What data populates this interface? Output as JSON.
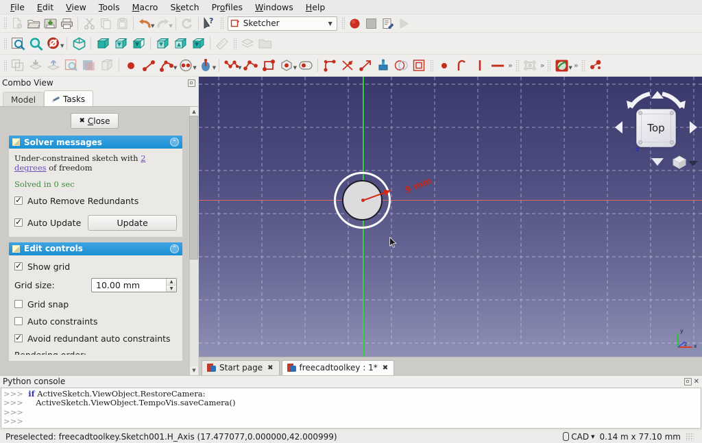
{
  "menubar": {
    "items": [
      {
        "label": "File",
        "mnemonic": "F"
      },
      {
        "label": "Edit",
        "mnemonic": "E"
      },
      {
        "label": "View",
        "mnemonic": "V"
      },
      {
        "label": "Tools",
        "mnemonic": "T"
      },
      {
        "label": "Macro",
        "mnemonic": "M"
      },
      {
        "label": "Sketch",
        "mnemonic": "k"
      },
      {
        "label": "Profiles",
        "mnemonic": "o"
      },
      {
        "label": "Windows",
        "mnemonic": "W"
      },
      {
        "label": "Help",
        "mnemonic": "H"
      }
    ]
  },
  "toolbar_file": {
    "buttons": [
      {
        "name": "new-document-icon",
        "title": "New"
      },
      {
        "name": "open-document-icon",
        "title": "Open"
      },
      {
        "name": "save-document-icon",
        "title": "Save"
      },
      {
        "name": "print-icon",
        "title": "Print"
      },
      {
        "name": "cut-icon",
        "title": "Cut"
      },
      {
        "name": "copy-icon",
        "title": "Copy"
      },
      {
        "name": "paste-icon",
        "title": "Paste"
      },
      {
        "name": "undo-icon",
        "title": "Undo"
      },
      {
        "name": "redo-icon",
        "title": "Redo"
      },
      {
        "name": "refresh-icon",
        "title": "Refresh"
      },
      {
        "name": "whats-this-icon",
        "title": "What's This?"
      }
    ]
  },
  "workbench": {
    "label": "Sketcher",
    "icon": "sketcher-workbench-icon",
    "arrow": "▼"
  },
  "toolbar_macro": {
    "buttons": [
      {
        "name": "macro-record-icon",
        "title": "Macro recording"
      },
      {
        "name": "macro-stop-icon",
        "title": "Stop macro recording"
      },
      {
        "name": "macros-dialog-icon",
        "title": "Macros..."
      },
      {
        "name": "macro-execute-icon",
        "title": "Execute macro"
      }
    ]
  },
  "toolbar_view": {
    "buttons": [
      {
        "name": "fit-all-icon",
        "title": "Fit all"
      },
      {
        "name": "fit-selection-icon",
        "title": "Fit selection"
      },
      {
        "name": "draw-style-icon",
        "title": "Draw style"
      },
      {
        "name": "isometric-view-icon",
        "title": "Isometric"
      },
      {
        "name": "front-view-icon",
        "title": "Front"
      },
      {
        "name": "top-view-icon",
        "title": "Top"
      },
      {
        "name": "right-view-icon",
        "title": "Right"
      },
      {
        "name": "rear-view-icon",
        "title": "Rear"
      },
      {
        "name": "bottom-view-icon",
        "title": "Bottom"
      },
      {
        "name": "left-view-icon",
        "title": "Left"
      },
      {
        "name": "measure-icon",
        "title": "Measure"
      },
      {
        "name": "workbench-layers-icon",
        "title": "Layers"
      },
      {
        "name": "folder-icon",
        "title": "Group"
      }
    ]
  },
  "toolbar_sketcher": {
    "buttons": [
      {
        "name": "create-sketch-icon",
        "title": "Create sketch"
      },
      {
        "name": "map-sketch-icon",
        "title": "Map sketch to face"
      },
      {
        "name": "reorient-sketch-icon",
        "title": "Reorient sketch"
      },
      {
        "name": "validate-sketch-icon",
        "title": "Validate sketch"
      },
      {
        "name": "merge-sketch-icon",
        "title": "Merge sketches"
      },
      {
        "name": "mirror-sketch-icon",
        "title": "Mirror sketch"
      },
      {
        "name": "point-geometry-icon",
        "title": "Create point"
      },
      {
        "name": "line-geometry-icon",
        "title": "Create line"
      },
      {
        "name": "arc-geometry-icon",
        "title": "Create arc"
      },
      {
        "name": "circle-geometry-icon",
        "title": "Create circle"
      },
      {
        "name": "conic-geometry-icon",
        "title": "Create conic"
      },
      {
        "name": "bspline-geometry-icon",
        "title": "Create B-spline"
      },
      {
        "name": "polyline-geometry-icon",
        "title": "Create polyline"
      },
      {
        "name": "rectangle-geometry-icon",
        "title": "Create rectangle"
      },
      {
        "name": "polygon-geometry-icon",
        "title": "Create regular polygon"
      },
      {
        "name": "slot-geometry-icon",
        "title": "Create slot"
      },
      {
        "name": "fillet-icon",
        "title": "Create fillet"
      },
      {
        "name": "trim-edge-icon",
        "title": "Trim edge"
      },
      {
        "name": "extend-edge-icon",
        "title": "Extend edge"
      },
      {
        "name": "external-geometry-icon",
        "title": "External geometry"
      },
      {
        "name": "carbon-copy-icon",
        "title": "Carbon copy"
      },
      {
        "name": "toggle-construction-icon",
        "title": "Toggle construction geometry"
      },
      {
        "name": "coincident-constraint-icon",
        "title": "Constrain coincident"
      },
      {
        "name": "tangent-constraint-icon",
        "title": "Constrain tangent"
      },
      {
        "name": "vertical-constraint-icon",
        "title": "Constrain vertical"
      },
      {
        "name": "horizontal-constraint-icon",
        "title": "Constrain horizontal"
      },
      {
        "name": "constraints-overflow-icon",
        "title": "More constraints"
      },
      {
        "name": "sketcher-tools-icon",
        "title": "Sketcher tools"
      },
      {
        "name": "tools-overflow-icon",
        "title": "More tools"
      },
      {
        "name": "visual-sketch-icon",
        "title": "Visual sketch settings"
      },
      {
        "name": "visual-overflow-icon",
        "title": "More"
      },
      {
        "name": "sketcher-virtual-space-icon",
        "title": "Virtual space"
      }
    ]
  },
  "combo_view": {
    "title": "Combo View",
    "float_icon": "undock-icon",
    "tabs": [
      {
        "label": "Model",
        "active": false,
        "icon": null
      },
      {
        "label": "Tasks",
        "active": true,
        "icon": "pencil-icon"
      }
    ],
    "close_button": {
      "label": "Close",
      "glyph": "✖"
    },
    "solver": {
      "header": "Solver messages",
      "collapse_glyph": "⌃",
      "message_prefix": "Under-constrained sketch with ",
      "message_link": "2 degrees",
      "message_suffix": " of freedom",
      "solved_text": "Solved in 0 sec",
      "auto_remove_redundants": {
        "label": "Auto Remove Redundants",
        "checked": true
      },
      "auto_update": {
        "label": "Auto Update",
        "checked": true
      },
      "update_button": "Update"
    },
    "edit_controls": {
      "header": "Edit controls",
      "collapse_glyph": "⌃",
      "show_grid": {
        "label": "Show grid",
        "checked": true
      },
      "grid_size_label": "Grid size:",
      "grid_size_value": "10.00 mm",
      "grid_snap": {
        "label": "Grid snap",
        "checked": false
      },
      "auto_constraints": {
        "label": "Auto constraints",
        "checked": false
      },
      "avoid_redundant": {
        "label": "Avoid redundant auto constraints",
        "checked": true
      },
      "rendering_order_label": "Rendering order:"
    }
  },
  "view3d": {
    "nav_cube_label": "Top",
    "nav_z_label": "z",
    "axis_labels": {
      "x": "x",
      "y": "y",
      "z": "z"
    },
    "dimension_label": "9 mm",
    "colors": {
      "h_axis": "#e46a62",
      "v_axis": "#37d23f",
      "constraint": "#d32a18",
      "edge": "#ffffff",
      "grid": "#cdcddd"
    }
  },
  "doc_tabs": [
    {
      "label": "Start page",
      "active": false,
      "close": "✖",
      "icon": "freecad-icon"
    },
    {
      "label": "freecadtoolkey : 1*",
      "active": true,
      "close": "✖",
      "icon": "freecad-icon"
    }
  ],
  "python_console": {
    "title": "Python console",
    "lines": [
      {
        "prompt": ">>>",
        "indent": 1,
        "keyword": "if",
        "text": " ActiveSketch.ViewObject.RestoreCamera:"
      },
      {
        "prompt": ">>>",
        "indent": 2,
        "keyword": "",
        "text": "ActiveSketch.ViewObject.TempoVis.saveCamera()"
      },
      {
        "prompt": ">>>",
        "indent": 0,
        "keyword": "",
        "text": ""
      },
      {
        "prompt": ">>>",
        "indent": 0,
        "keyword": "",
        "text": ""
      }
    ]
  },
  "status_bar": {
    "message": "Preselected: freecadtoolkey.Sketch001.H_Axis (17.477077,0.000000,42.000999)",
    "unit_system": "CAD",
    "unit_caret": "▼",
    "dimensions": "0.14 m x 77.10 mm"
  }
}
